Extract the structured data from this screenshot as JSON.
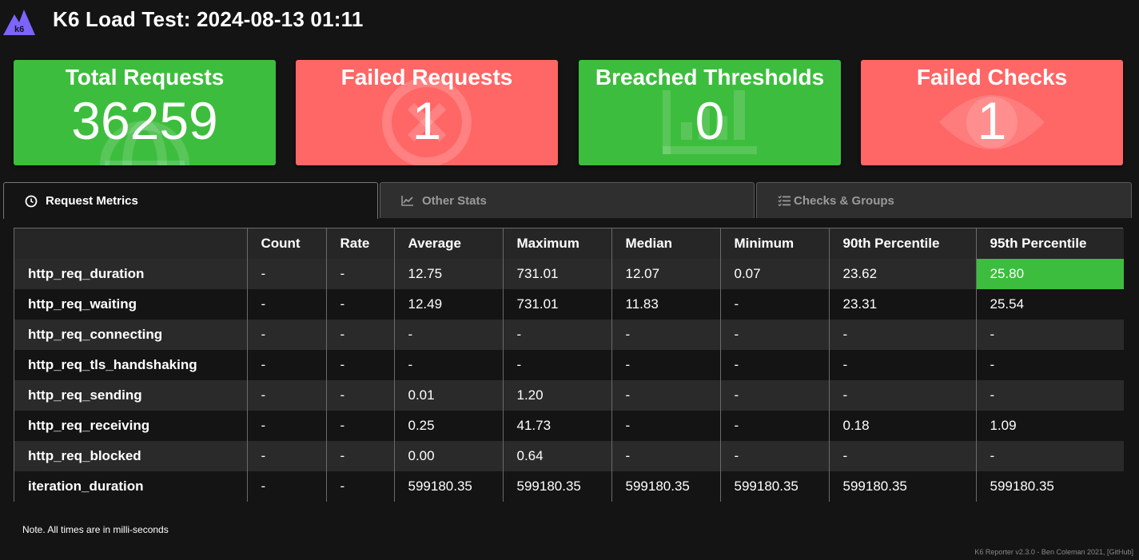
{
  "header": {
    "logo_text": "k6",
    "title": "K6 Load Test: 2024-08-13 01:11"
  },
  "cards": [
    {
      "title": "Total Requests",
      "value": "36259",
      "status": "green",
      "icon": "globe-icon"
    },
    {
      "title": "Failed Requests",
      "value": "1",
      "status": "red",
      "icon": "x-circle-icon"
    },
    {
      "title": "Breached Thresholds",
      "value": "0",
      "status": "green",
      "icon": "bar-chart-icon"
    },
    {
      "title": "Failed Checks",
      "value": "1",
      "status": "red",
      "icon": "eye-icon"
    }
  ],
  "colors": {
    "green": "#3dbd3d",
    "red": "#ff6666",
    "background": "#141414"
  },
  "tabs": [
    {
      "label": "Request Metrics",
      "icon": "clock-icon",
      "active": true
    },
    {
      "label": "Other Stats",
      "icon": "line-chart-icon",
      "active": false
    },
    {
      "label": "Checks & Groups",
      "icon": "checklist-icon",
      "active": false
    }
  ],
  "table": {
    "headers": [
      "",
      "Count",
      "Rate",
      "Average",
      "Maximum",
      "Median",
      "Minimum",
      "90th Percentile",
      "95th Percentile"
    ],
    "rows": [
      [
        "http_req_duration",
        "-",
        "-",
        "12.75",
        "731.01",
        "12.07",
        "0.07",
        "23.62",
        "25.80"
      ],
      [
        "http_req_waiting",
        "-",
        "-",
        "12.49",
        "731.01",
        "11.83",
        "-",
        "23.31",
        "25.54"
      ],
      [
        "http_req_connecting",
        "-",
        "-",
        "-",
        "-",
        "-",
        "-",
        "-",
        "-"
      ],
      [
        "http_req_tls_handshaking",
        "-",
        "-",
        "-",
        "-",
        "-",
        "-",
        "-",
        "-"
      ],
      [
        "http_req_sending",
        "-",
        "-",
        "0.01",
        "1.20",
        "-",
        "-",
        "-",
        "-"
      ],
      [
        "http_req_receiving",
        "-",
        "-",
        "0.25",
        "41.73",
        "-",
        "-",
        "0.18",
        "1.09"
      ],
      [
        "http_req_blocked",
        "-",
        "-",
        "0.00",
        "0.64",
        "-",
        "-",
        "-",
        "-"
      ],
      [
        "iteration_duration",
        "-",
        "-",
        "599180.35",
        "599180.35",
        "599180.35",
        "599180.35",
        "599180.35",
        "599180.35"
      ]
    ]
  },
  "note": "Note. All times are in milli-seconds",
  "footer": "K6 Reporter v2.3.0 - Ben Coleman 2021, [GitHub]"
}
